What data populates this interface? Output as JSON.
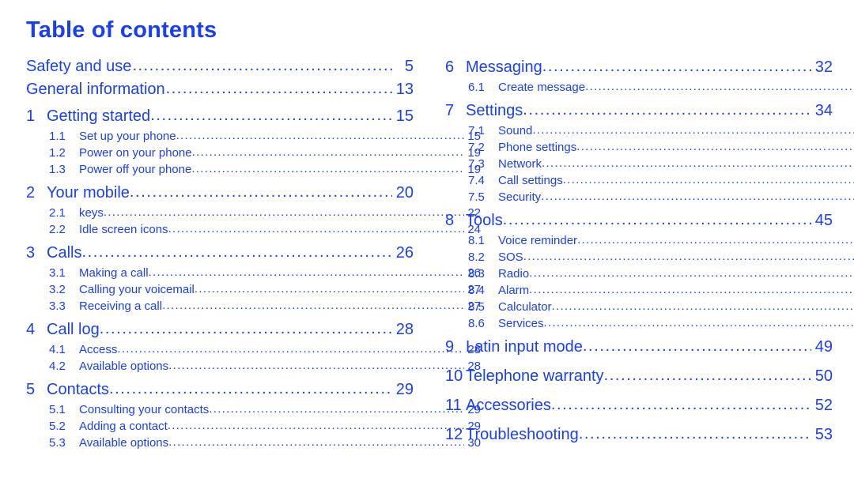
{
  "document": {
    "title": "Table of contents",
    "accent_color": "#1a3ff0",
    "background_color": "#ffffff",
    "leader_style": "dotted"
  },
  "left_column": {
    "front_matter": [
      {
        "label": "Safety and use",
        "page": "5"
      },
      {
        "label": "General information",
        "page": "13"
      }
    ],
    "chapters": [
      {
        "number": "1",
        "label": "Getting started",
        "page": "15",
        "subsections": [
          {
            "number": "1.1",
            "label": "Set up your phone",
            "page": "15"
          },
          {
            "number": "1.2",
            "label": "Power on your phone",
            "page": "19"
          },
          {
            "number": "1.3",
            "label": "Power off your phone",
            "page": "19"
          }
        ]
      },
      {
        "number": "2",
        "label": "Your mobile",
        "page": "20",
        "subsections": [
          {
            "number": "2.1",
            "label": "keys",
            "page": "22"
          },
          {
            "number": "2.2",
            "label": "Idle screen icons",
            "page": "24"
          }
        ]
      },
      {
        "number": "3",
        "label": "Calls",
        "page": "26",
        "subsections": [
          {
            "number": "3.1",
            "label": "Making a call",
            "page": "26"
          },
          {
            "number": "3.2",
            "label": "Calling your voicemail",
            "page": "27"
          },
          {
            "number": "3.3",
            "label": "Receiving a call",
            "page": "27"
          }
        ]
      },
      {
        "number": "4",
        "label": "Call log",
        "page": "28",
        "subsections": [
          {
            "number": "4.1",
            "label": "Access",
            "page": "28"
          },
          {
            "number": "4.2",
            "label": "Available options",
            "page": "28"
          }
        ]
      },
      {
        "number": "5",
        "label": "Contacts",
        "page": "29",
        "subsections": [
          {
            "number": "5.1",
            "label": "Consulting your contacts",
            "page": "29"
          },
          {
            "number": "5.2",
            "label": "Adding a contact",
            "page": "29"
          },
          {
            "number": "5.3",
            "label": "Available options",
            "page": "30"
          }
        ]
      }
    ]
  },
  "right_column": {
    "chapters": [
      {
        "number": "6",
        "label": "Messaging",
        "page": "32",
        "subsections": [
          {
            "number": "6.1",
            "label": "Create message",
            "page": ""
          }
        ]
      },
      {
        "number": "7",
        "label": "Settings",
        "page": "34",
        "subsections": [
          {
            "number": "7.1",
            "label": "Sound",
            "page": ""
          },
          {
            "number": "7.2",
            "label": "Phone settings",
            "page": ""
          },
          {
            "number": "7.3",
            "label": "Network",
            "page": ""
          },
          {
            "number": "7.4",
            "label": "Call settings",
            "page": ""
          },
          {
            "number": "7.5",
            "label": "Security",
            "page": ""
          }
        ]
      },
      {
        "number": "8",
        "label": "Tools",
        "page": "45",
        "subsections": [
          {
            "number": "8.1",
            "label": "Voice reminder",
            "page": ""
          },
          {
            "number": "8.2",
            "label": "SOS",
            "page": ""
          },
          {
            "number": "8.3",
            "label": "Radio",
            "page": ""
          },
          {
            "number": "8.4",
            "label": "Alarm",
            "page": ""
          },
          {
            "number": "8.5",
            "label": "Calculator",
            "page": ""
          },
          {
            "number": "8.6",
            "label": "Services",
            "page": ""
          }
        ]
      },
      {
        "number": "9",
        "label": "Latin input mode",
        "page": "49",
        "subsections": []
      },
      {
        "number": "10",
        "label": "Telephone warranty",
        "page": "50",
        "subsections": []
      },
      {
        "number": "11",
        "label": "Accessories",
        "page": "52",
        "subsections": []
      },
      {
        "number": "12",
        "label": "Troubleshooting",
        "page": "53",
        "subsections": []
      }
    ]
  }
}
